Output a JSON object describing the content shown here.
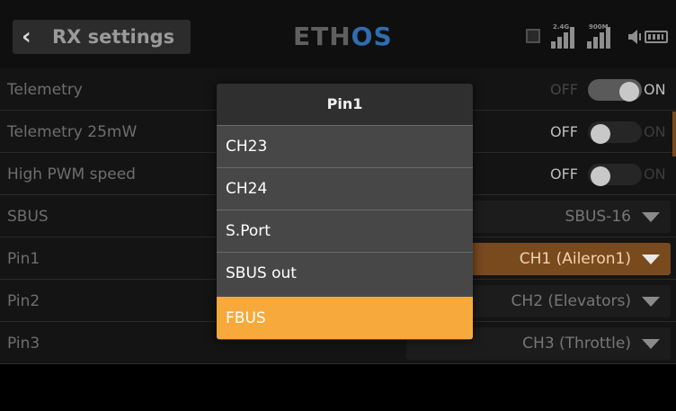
{
  "header": {
    "back_icon": "chevron-left",
    "title": "RX settings",
    "logo_prefix": "ETH",
    "logo_suffix": "OS",
    "signal_label_1": "2.4G",
    "signal_label_2": "900M"
  },
  "rows": [
    {
      "label": "Telemetry",
      "off": "OFF",
      "on": "ON",
      "state": "on"
    },
    {
      "label": "Telemetry 25mW",
      "off": "OFF",
      "on": "ON",
      "state": "off"
    },
    {
      "label": "High PWM speed",
      "off": "OFF",
      "on": "ON",
      "state": "off"
    },
    {
      "label": "SBUS",
      "value": "SBUS-16"
    },
    {
      "label": "Pin1",
      "value": "CH1 (Aileron1)"
    },
    {
      "label": "Pin2",
      "value": "CH2 (Elevators)"
    },
    {
      "label": "Pin3",
      "value": "CH3 (Throttle)"
    }
  ],
  "dialog": {
    "title": "Pin1",
    "options": [
      "CH23",
      "CH24",
      "S.Port",
      "SBUS out",
      "FBUS"
    ],
    "selected": "FBUS"
  },
  "colors": {
    "accent": "#f7a93c",
    "selected_row_bg": "#7a4a1f",
    "logo_os": "#2f6db0"
  }
}
